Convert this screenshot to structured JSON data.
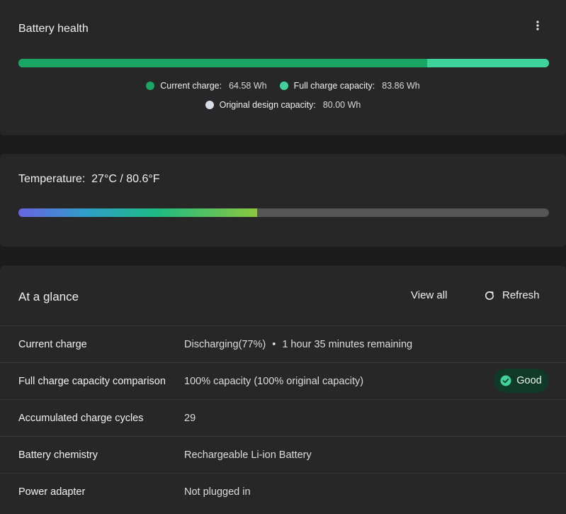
{
  "battery_health": {
    "title": "Battery health",
    "current_charge_wh": 64.58,
    "full_charge_wh": 83.86,
    "legend": {
      "current_label": "Current charge:",
      "current_value": "64.58 Wh",
      "full_label": "Full charge capacity:",
      "full_value": "83.86 Wh",
      "original_label": "Original design capacity:",
      "original_value": "80.00 Wh"
    },
    "colors": {
      "current": "#1aa564",
      "full": "#3ed39a",
      "original": "#d6dce4"
    }
  },
  "temperature": {
    "label": "Temperature:",
    "value": "27°C / 80.6°F",
    "level_percent": 45
  },
  "at_a_glance": {
    "title": "At a glance",
    "view_all_label": "View all",
    "refresh_label": "Refresh",
    "rows": [
      {
        "label": "Current charge",
        "status": "Discharging(77%)",
        "bullet": "•",
        "remaining": "1 hour 35 minutes remaining"
      },
      {
        "label": "Full charge capacity comparison",
        "value": "100% capacity (100% original capacity)",
        "badge": "Good"
      },
      {
        "label": "Accumulated charge cycles",
        "value": "29"
      },
      {
        "label": "Battery chemistry",
        "value": "Rechargeable Li-ion Battery"
      },
      {
        "label": "Power adapter",
        "value": "Not plugged in"
      }
    ]
  },
  "icons": [
    "more-vertical-icon",
    "refresh-icon",
    "check-circle-icon"
  ]
}
